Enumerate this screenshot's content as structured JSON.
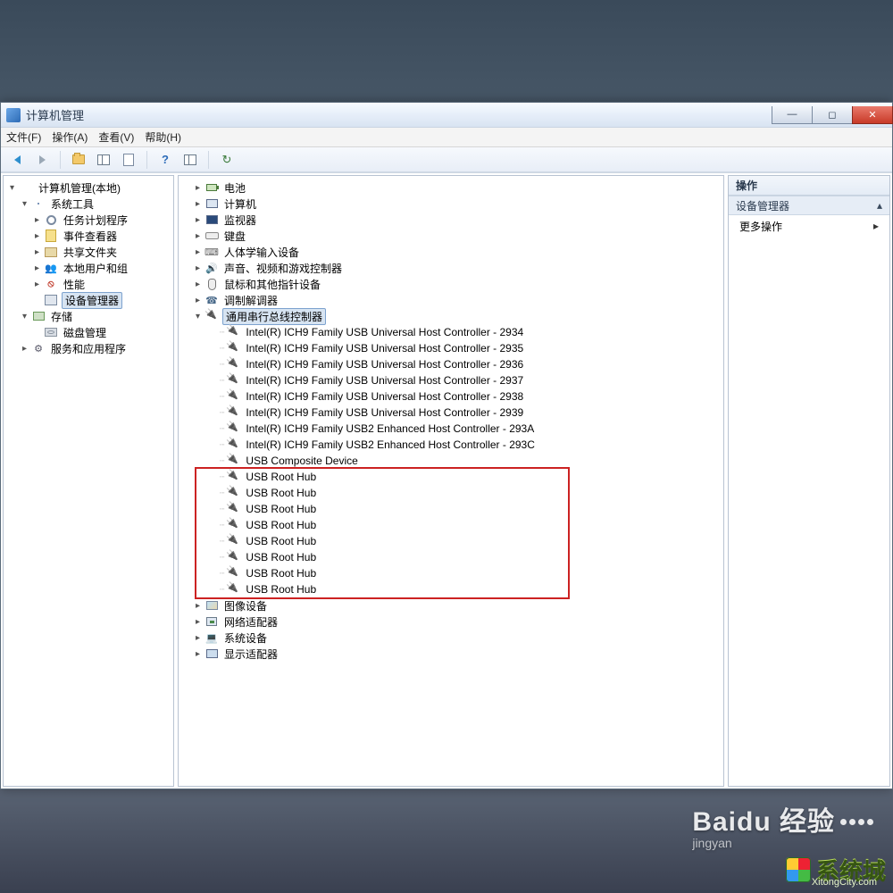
{
  "window": {
    "title": "计算机管理"
  },
  "menubar": [
    "文件(F)",
    "操作(A)",
    "查看(V)",
    "帮助(H)"
  ],
  "left_tree": {
    "root": "计算机管理(本地)",
    "sys_tools": "系统工具",
    "sys_children": [
      "任务计划程序",
      "事件查看器",
      "共享文件夹",
      "本地用户和组",
      "性能",
      "设备管理器"
    ],
    "storage": "存储",
    "storage_children": [
      "磁盘管理"
    ],
    "services": "服务和应用程序"
  },
  "center_tree": {
    "collapsed": [
      "电池",
      "计算机",
      "监视器",
      "键盘",
      "人体学输入设备",
      "声音、视频和游戏控制器",
      "鼠标和其他指针设备",
      "调制解调器"
    ],
    "usb_root": "通用串行总线控制器",
    "usb_children": [
      "Intel(R) ICH9 Family USB Universal Host Controller - 2934",
      "Intel(R) ICH9 Family USB Universal Host Controller - 2935",
      "Intel(R) ICH9 Family USB Universal Host Controller - 2936",
      "Intel(R) ICH9 Family USB Universal Host Controller - 2937",
      "Intel(R) ICH9 Family USB Universal Host Controller - 2938",
      "Intel(R) ICH9 Family USB Universal Host Controller - 2939",
      "Intel(R) ICH9 Family USB2 Enhanced Host Controller - 293A",
      "Intel(R) ICH9 Family USB2 Enhanced Host Controller - 293C",
      "USB Composite Device",
      "USB Root Hub",
      "USB Root Hub",
      "USB Root Hub",
      "USB Root Hub",
      "USB Root Hub",
      "USB Root Hub",
      "USB Root Hub",
      "USB Root Hub"
    ],
    "after": [
      "图像设备",
      "网络适配器",
      "系统设备",
      "显示适配器"
    ]
  },
  "right_panel": {
    "header": "操作",
    "section": "设备管理器",
    "item": "更多操作"
  },
  "watermark": {
    "baidu": "Baidu 经验",
    "baidu_sub": "jingyan",
    "xtc": "系统城",
    "xtc_url": "XitongCity.com"
  }
}
